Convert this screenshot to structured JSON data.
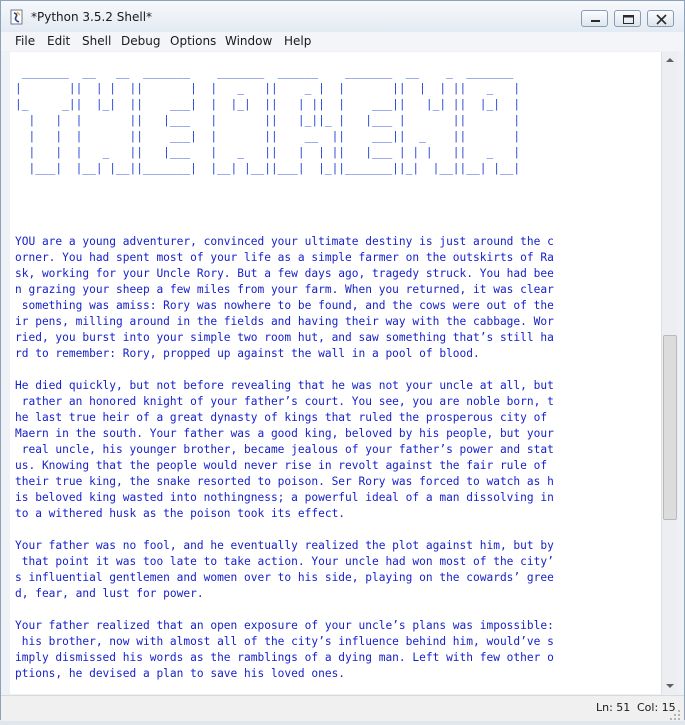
{
  "window": {
    "title": "*Python 3.5.2 Shell*"
  },
  "menu": [
    "File",
    "Edit",
    "Shell",
    "Debug",
    "Options",
    "Window",
    "Help"
  ],
  "shell": {
    "banner_art": [
      " _______  __   __  _______    _______  ______    _______  __    _  _______ ",
      "|       ||  | |  ||       |  |   _   ||    _ |  |       ||  |  | ||   _   |",
      "|_     _||  |_|  ||    ___|  |  |_|  ||   | ||  |    ___||   |_| ||  |_|  |",
      "  |   |  |       ||   |___   |       ||   |_||_ |   |___ |       ||       |",
      "  |   |  |       ||    ___|  |       ||    __  ||    ___||  _    ||       |",
      "  |   |  |   _   ||   |___   |   _   ||   |  | ||   |___ | | |   ||   _   |",
      "  |___|  |__| |__||_______|  |__| |__||___|  |_||_______||_|  |__||__| |__|",
      "",
      ""
    ],
    "story": [
      [
        "YOU are a young adventurer, convinced your ultimate destiny is just around the c",
        "orner. You had spent most of your life as a simple farmer on the outskirts of Ra",
        "sk, working for your Uncle Rory. But a few days ago, tragedy struck. You had bee",
        "n grazing your sheep a few miles from your farm. When you returned, it was clear",
        " something was amiss: Rory was nowhere to be found, and the cows were out of the",
        "ir pens, milling around in the fields and having their way with the cabbage. Wor",
        "ried, you burst into your simple two room hut, and saw something that’s still ha",
        "rd to remember: Rory, propped up against the wall in a pool of blood."
      ],
      [
        "He died quickly, but not before revealing that he was not your uncle at all, but",
        " rather an honored knight of your father’s court. You see, you are noble born, t",
        "he last true heir of a great dynasty of kings that ruled the prosperous city of",
        "Maern in the south. Your father was a good king, beloved by his people, but your",
        " real uncle, his younger brother, became jealous of your father’s power and stat",
        "us. Knowing that the people would never rise in revolt against the fair rule of",
        "their true king, the snake resorted to poison. Ser Rory was forced to watch as h",
        "is beloved king wasted into nothingness; a powerful ideal of a man dissolving in",
        "to a withered husk as the poison took its effect."
      ],
      [
        "Your father was no fool, and he eventually realized the plot against him, but by",
        " that point it was too late to take action. Your uncle had won most of the city’",
        "s influential gentlemen and women over to his side, playing on the cowards’ gree",
        "d, fear, and lust for power."
      ],
      [
        "Your father realized that an open exposure of your uncle’s plans was impossible:",
        " his brother, now with almost all of the city’s influence behind him, would’ve s",
        "imply dismissed his words as the ramblings of a dying man. Left with few other o",
        "ptions, he devised a plan to save his loved ones."
      ]
    ]
  },
  "status": {
    "ln": "Ln: 51",
    "col": "Col: 15"
  },
  "colors": {
    "text": "#1722c9",
    "banner": "#2a47d6",
    "chrome": "#eef2f7"
  },
  "icons": {
    "app": "python-feather-icon",
    "minimize": "minimize-icon",
    "maximize": "maximize-icon",
    "close": "close-icon",
    "scroll_up": "arrow-up-icon",
    "scroll_down": "arrow-down-icon"
  }
}
